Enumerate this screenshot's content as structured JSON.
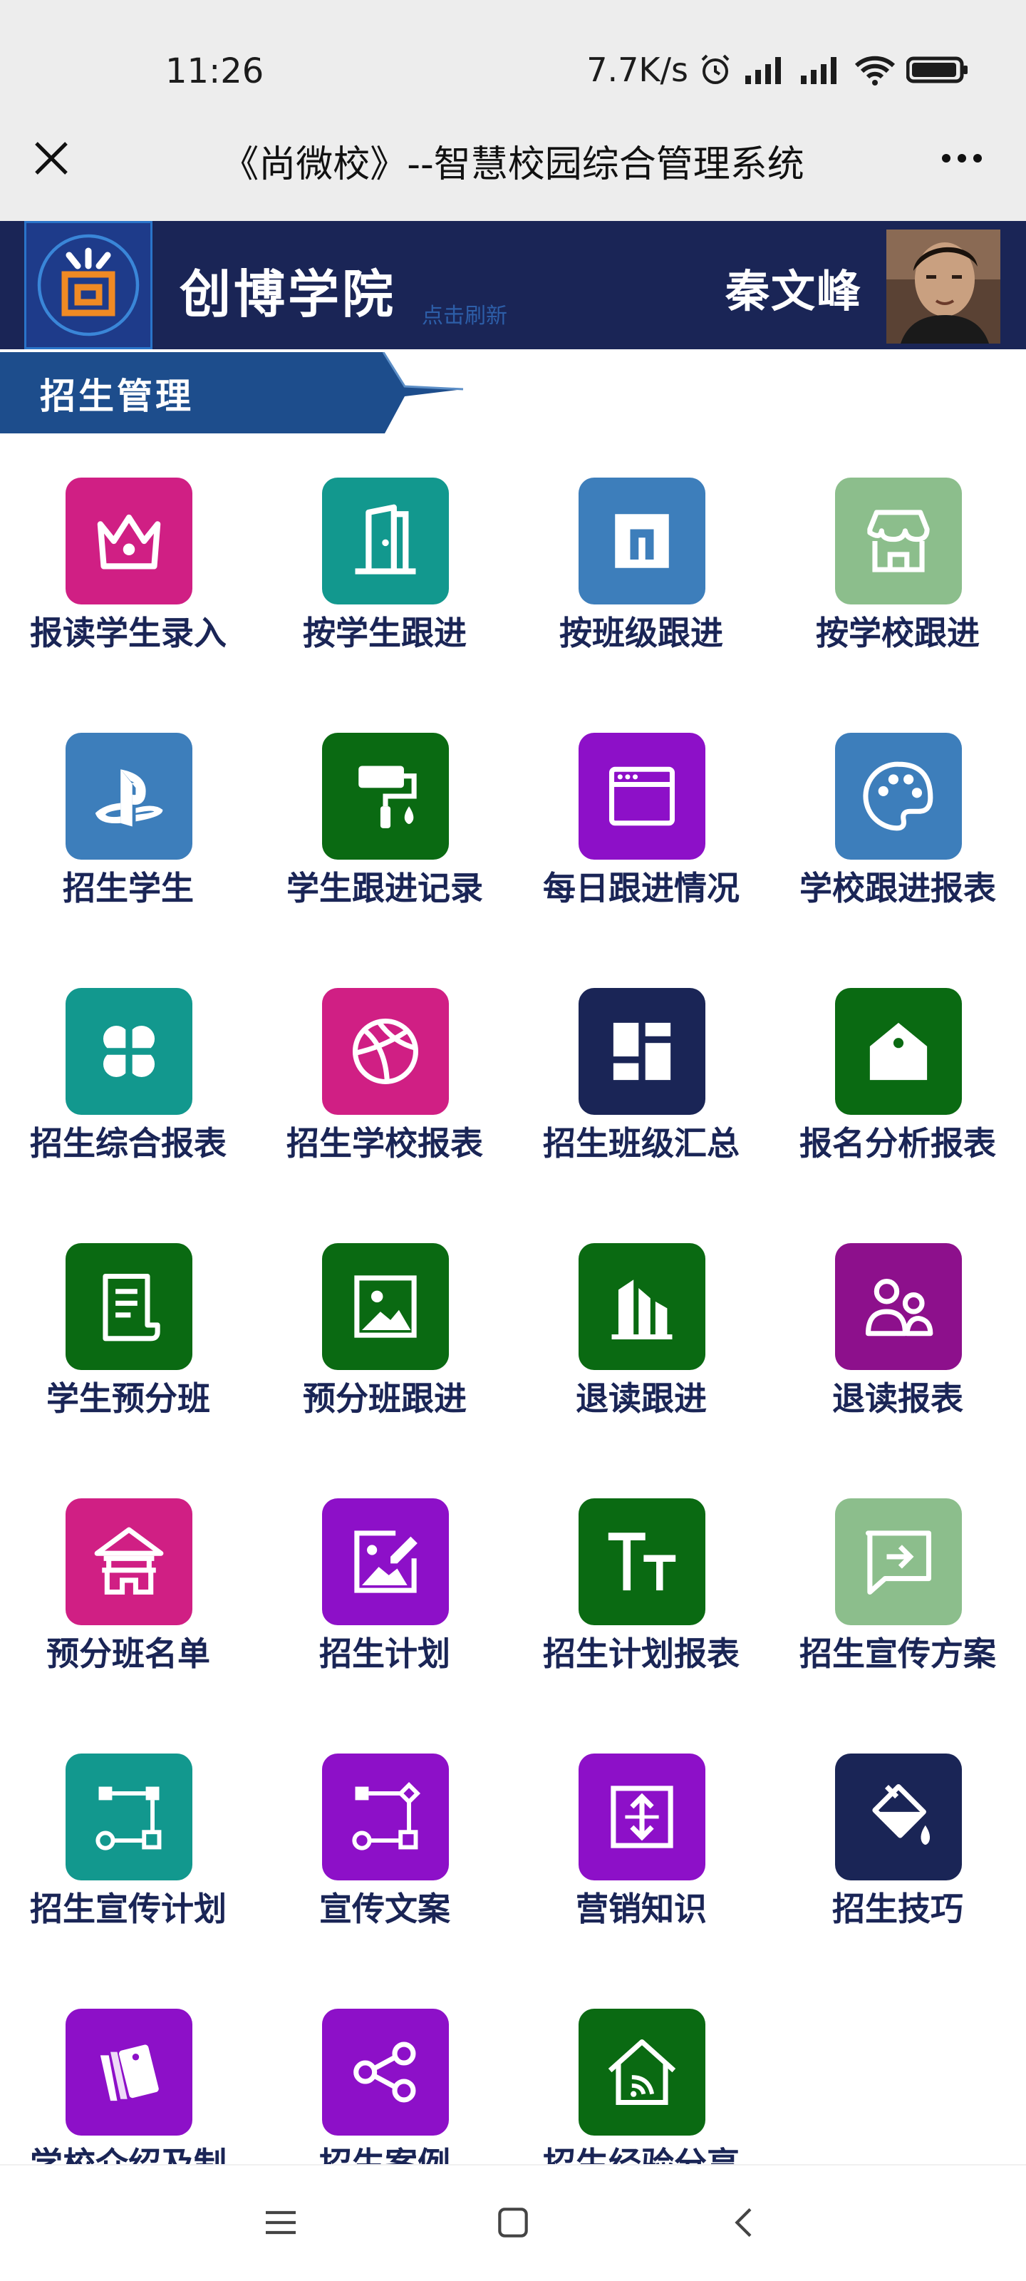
{
  "status": {
    "time": "11:26",
    "speed": "7.7K/s"
  },
  "wechat": {
    "title": "《尚微校》--智慧校园综合管理系统"
  },
  "banner": {
    "logo_text": "尚",
    "school_name": "创博学院",
    "refresh_label": "点击刷新",
    "user_name": "秦文峰"
  },
  "section": {
    "title": "招生管理"
  },
  "colors": {
    "banner_bg": "#1a2556",
    "tab_bg": "#1d4d8c",
    "label": "#1a2556"
  },
  "grid_items": [
    {
      "label": "报读学生录入",
      "icon": "crown-icon",
      "color": "#d01f84"
    },
    {
      "label": "按学生跟进",
      "icon": "door-icon",
      "color": "#12988e"
    },
    {
      "label": "按班级跟进",
      "icon": "square-frame-icon",
      "color": "#3d7ebb"
    },
    {
      "label": "按学校跟进",
      "icon": "store-icon",
      "color": "#8cbe8c"
    },
    {
      "label": "招生学生",
      "icon": "playstation-icon",
      "color": "#3d7ebb"
    },
    {
      "label": "学生跟进记录",
      "icon": "paint-roller-icon",
      "color": "#0a6a12"
    },
    {
      "label": "每日跟进情况",
      "icon": "browser-window-icon",
      "color": "#8d10c8"
    },
    {
      "label": "学校跟进报表",
      "icon": "palette-icon",
      "color": "#3d7ebb"
    },
    {
      "label": "招生综合报表",
      "icon": "four-leaf-icon",
      "color": "#12988e"
    },
    {
      "label": "招生学校报表",
      "icon": "basketball-icon",
      "color": "#d01f84"
    },
    {
      "label": "招生班级汇总",
      "icon": "dashboard-layout-icon",
      "color": "#1a2556"
    },
    {
      "label": "报名分析报表",
      "icon": "home-tag-icon",
      "color": "#0a6a12"
    },
    {
      "label": "学生预分班",
      "icon": "document-icon",
      "color": "#0a6a12"
    },
    {
      "label": "预分班跟进",
      "icon": "image-icon",
      "color": "#0a6a12"
    },
    {
      "label": "退读跟进",
      "icon": "buildings-icon",
      "color": "#0a6a12"
    },
    {
      "label": "退读报表",
      "icon": "users-icon",
      "color": "#8d108c"
    },
    {
      "label": "预分班名单",
      "icon": "pavilion-icon",
      "color": "#d01f84"
    },
    {
      "label": "招生计划",
      "icon": "image-edit-icon",
      "color": "#8d10c8"
    },
    {
      "label": "招生计划报表",
      "icon": "text-size-icon",
      "color": "#0a6a12"
    },
    {
      "label": "招生宣传方案",
      "icon": "message-arrow-icon",
      "color": "#8cbe8c"
    },
    {
      "label": "招生宣传计划",
      "icon": "flow-nodes-icon",
      "color": "#12988e"
    },
    {
      "label": "宣传文案",
      "icon": "flow-diamond-icon",
      "color": "#8d10c8"
    },
    {
      "label": "营销知识",
      "icon": "expand-vertical-icon",
      "color": "#8d10c8"
    },
    {
      "label": "招生技巧",
      "icon": "paint-bucket-icon",
      "color": "#1a2556"
    },
    {
      "label": "学校介绍及制",
      "icon": "cards-icon",
      "color": "#8d10c8"
    },
    {
      "label": "招生案例",
      "icon": "share-nodes-icon",
      "color": "#8d10c8"
    },
    {
      "label": "招生经验分享",
      "icon": "home-wifi-icon",
      "color": "#0a6a12"
    }
  ]
}
